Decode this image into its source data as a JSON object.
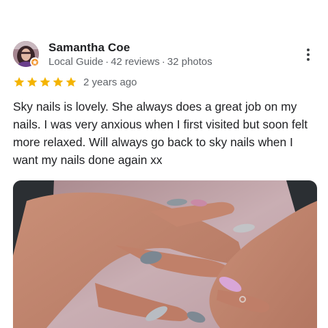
{
  "reviewer": {
    "name": "Samantha Coe",
    "badge": "Local Guide",
    "reviews": "42 reviews",
    "photos": "32 photos",
    "separator": "·",
    "avatar_icon": "avatar-photo",
    "badge_icon": "local-guide-star-icon"
  },
  "menu": {
    "icon": "more-vert-icon"
  },
  "rating": {
    "stars": 5,
    "max_stars": 5,
    "date": "2 years ago",
    "star_color": "#f4b400"
  },
  "review": {
    "text": "Sky nails is lovely. She always does a great job on my nails. I was very anxious when I first visited but soon felt more relaxed. Will always go back to sky nails when I want my nails done again xx"
  },
  "photo": {
    "subject": "review-photo-nails"
  },
  "colors": {
    "text_primary": "#202124",
    "text_secondary": "#5f6368",
    "badge_orange": "#f29a38"
  }
}
